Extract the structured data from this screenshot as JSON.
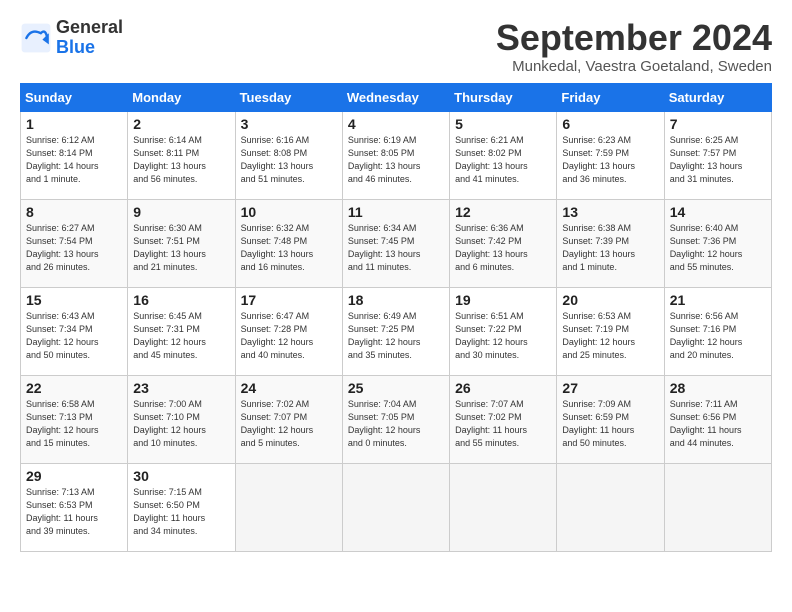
{
  "header": {
    "logo_line1": "General",
    "logo_line2": "Blue",
    "month": "September 2024",
    "location": "Munkedal, Vaestra Goetaland, Sweden"
  },
  "weekdays": [
    "Sunday",
    "Monday",
    "Tuesday",
    "Wednesday",
    "Thursday",
    "Friday",
    "Saturday"
  ],
  "weeks": [
    [
      {
        "day": "1",
        "info": "Sunrise: 6:12 AM\nSunset: 8:14 PM\nDaylight: 14 hours\nand 1 minute."
      },
      {
        "day": "2",
        "info": "Sunrise: 6:14 AM\nSunset: 8:11 PM\nDaylight: 13 hours\nand 56 minutes."
      },
      {
        "day": "3",
        "info": "Sunrise: 6:16 AM\nSunset: 8:08 PM\nDaylight: 13 hours\nand 51 minutes."
      },
      {
        "day": "4",
        "info": "Sunrise: 6:19 AM\nSunset: 8:05 PM\nDaylight: 13 hours\nand 46 minutes."
      },
      {
        "day": "5",
        "info": "Sunrise: 6:21 AM\nSunset: 8:02 PM\nDaylight: 13 hours\nand 41 minutes."
      },
      {
        "day": "6",
        "info": "Sunrise: 6:23 AM\nSunset: 7:59 PM\nDaylight: 13 hours\nand 36 minutes."
      },
      {
        "day": "7",
        "info": "Sunrise: 6:25 AM\nSunset: 7:57 PM\nDaylight: 13 hours\nand 31 minutes."
      }
    ],
    [
      {
        "day": "8",
        "info": "Sunrise: 6:27 AM\nSunset: 7:54 PM\nDaylight: 13 hours\nand 26 minutes."
      },
      {
        "day": "9",
        "info": "Sunrise: 6:30 AM\nSunset: 7:51 PM\nDaylight: 13 hours\nand 21 minutes."
      },
      {
        "day": "10",
        "info": "Sunrise: 6:32 AM\nSunset: 7:48 PM\nDaylight: 13 hours\nand 16 minutes."
      },
      {
        "day": "11",
        "info": "Sunrise: 6:34 AM\nSunset: 7:45 PM\nDaylight: 13 hours\nand 11 minutes."
      },
      {
        "day": "12",
        "info": "Sunrise: 6:36 AM\nSunset: 7:42 PM\nDaylight: 13 hours\nand 6 minutes."
      },
      {
        "day": "13",
        "info": "Sunrise: 6:38 AM\nSunset: 7:39 PM\nDaylight: 13 hours\nand 1 minute."
      },
      {
        "day": "14",
        "info": "Sunrise: 6:40 AM\nSunset: 7:36 PM\nDaylight: 12 hours\nand 55 minutes."
      }
    ],
    [
      {
        "day": "15",
        "info": "Sunrise: 6:43 AM\nSunset: 7:34 PM\nDaylight: 12 hours\nand 50 minutes."
      },
      {
        "day": "16",
        "info": "Sunrise: 6:45 AM\nSunset: 7:31 PM\nDaylight: 12 hours\nand 45 minutes."
      },
      {
        "day": "17",
        "info": "Sunrise: 6:47 AM\nSunset: 7:28 PM\nDaylight: 12 hours\nand 40 minutes."
      },
      {
        "day": "18",
        "info": "Sunrise: 6:49 AM\nSunset: 7:25 PM\nDaylight: 12 hours\nand 35 minutes."
      },
      {
        "day": "19",
        "info": "Sunrise: 6:51 AM\nSunset: 7:22 PM\nDaylight: 12 hours\nand 30 minutes."
      },
      {
        "day": "20",
        "info": "Sunrise: 6:53 AM\nSunset: 7:19 PM\nDaylight: 12 hours\nand 25 minutes."
      },
      {
        "day": "21",
        "info": "Sunrise: 6:56 AM\nSunset: 7:16 PM\nDaylight: 12 hours\nand 20 minutes."
      }
    ],
    [
      {
        "day": "22",
        "info": "Sunrise: 6:58 AM\nSunset: 7:13 PM\nDaylight: 12 hours\nand 15 minutes."
      },
      {
        "day": "23",
        "info": "Sunrise: 7:00 AM\nSunset: 7:10 PM\nDaylight: 12 hours\nand 10 minutes."
      },
      {
        "day": "24",
        "info": "Sunrise: 7:02 AM\nSunset: 7:07 PM\nDaylight: 12 hours\nand 5 minutes."
      },
      {
        "day": "25",
        "info": "Sunrise: 7:04 AM\nSunset: 7:05 PM\nDaylight: 12 hours\nand 0 minutes."
      },
      {
        "day": "26",
        "info": "Sunrise: 7:07 AM\nSunset: 7:02 PM\nDaylight: 11 hours\nand 55 minutes."
      },
      {
        "day": "27",
        "info": "Sunrise: 7:09 AM\nSunset: 6:59 PM\nDaylight: 11 hours\nand 50 minutes."
      },
      {
        "day": "28",
        "info": "Sunrise: 7:11 AM\nSunset: 6:56 PM\nDaylight: 11 hours\nand 44 minutes."
      }
    ],
    [
      {
        "day": "29",
        "info": "Sunrise: 7:13 AM\nSunset: 6:53 PM\nDaylight: 11 hours\nand 39 minutes."
      },
      {
        "day": "30",
        "info": "Sunrise: 7:15 AM\nSunset: 6:50 PM\nDaylight: 11 hours\nand 34 minutes."
      },
      {
        "day": "",
        "info": ""
      },
      {
        "day": "",
        "info": ""
      },
      {
        "day": "",
        "info": ""
      },
      {
        "day": "",
        "info": ""
      },
      {
        "day": "",
        "info": ""
      }
    ]
  ]
}
